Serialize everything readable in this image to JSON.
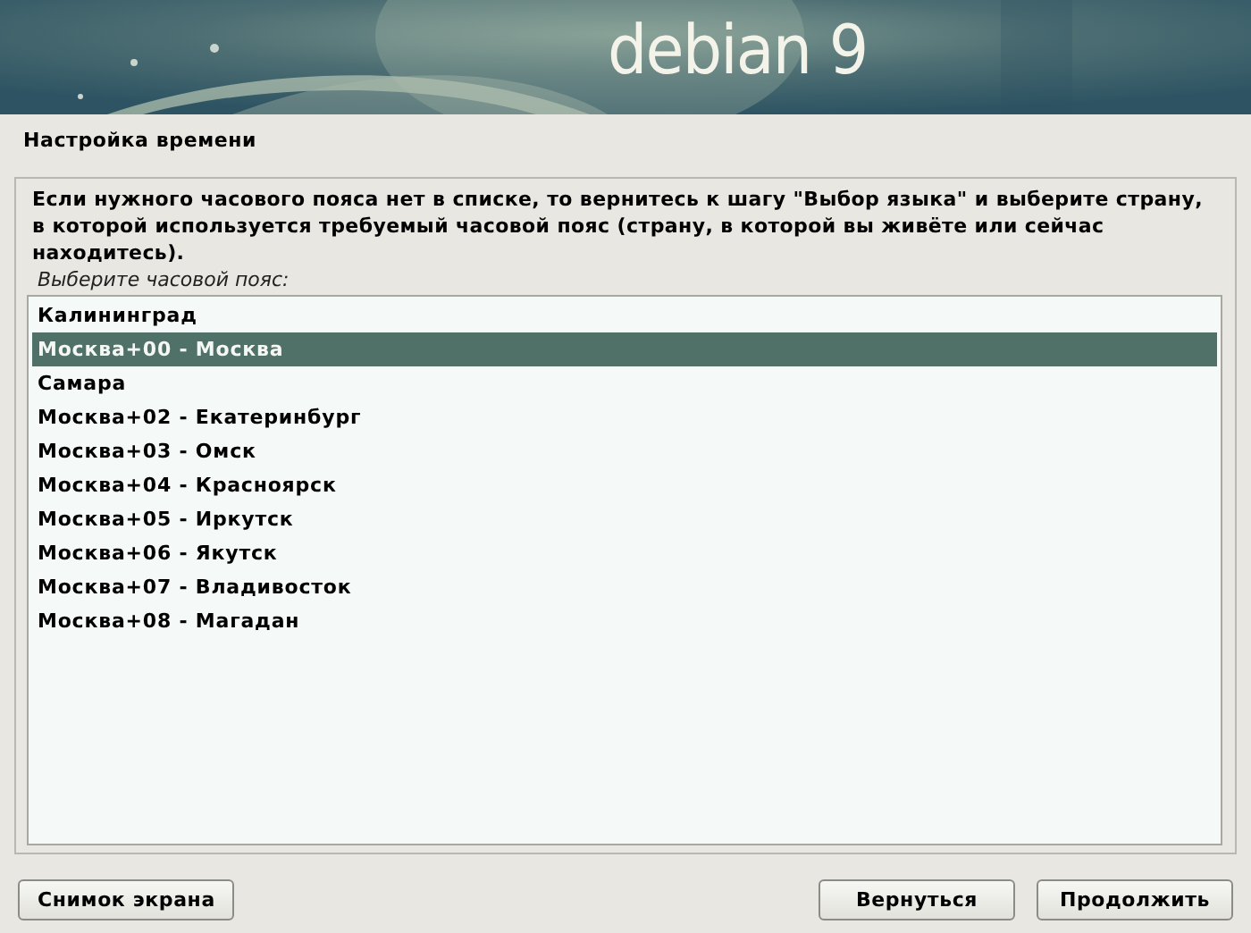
{
  "banner": {
    "logo": "debian 9"
  },
  "title": "Настройка времени",
  "instruction": "Если нужного часового пояса нет в списке, то вернитесь к шагу \"Выбор языка\" и выберите страну, в которой используется требуемый часовой пояс (страну, в которой вы живёте или сейчас находитесь).",
  "prompt": "Выберите часовой пояс:",
  "timezones": [
    {
      "label": "Калининград",
      "selected": false
    },
    {
      "label": "Москва+00 - Москва",
      "selected": true
    },
    {
      "label": "Самара",
      "selected": false
    },
    {
      "label": "Москва+02 - Екатеринбург",
      "selected": false
    },
    {
      "label": "Москва+03 - Омск",
      "selected": false
    },
    {
      "label": "Москва+04 - Красноярск",
      "selected": false
    },
    {
      "label": "Москва+05 - Иркутск",
      "selected": false
    },
    {
      "label": "Москва+06 - Якутск",
      "selected": false
    },
    {
      "label": "Москва+07 - Владивосток",
      "selected": false
    },
    {
      "label": "Москва+08 - Магадан",
      "selected": false
    }
  ],
  "buttons": {
    "left": [
      "Снимок экрана"
    ],
    "right": [
      "Вернуться",
      "Продолжить"
    ]
  }
}
